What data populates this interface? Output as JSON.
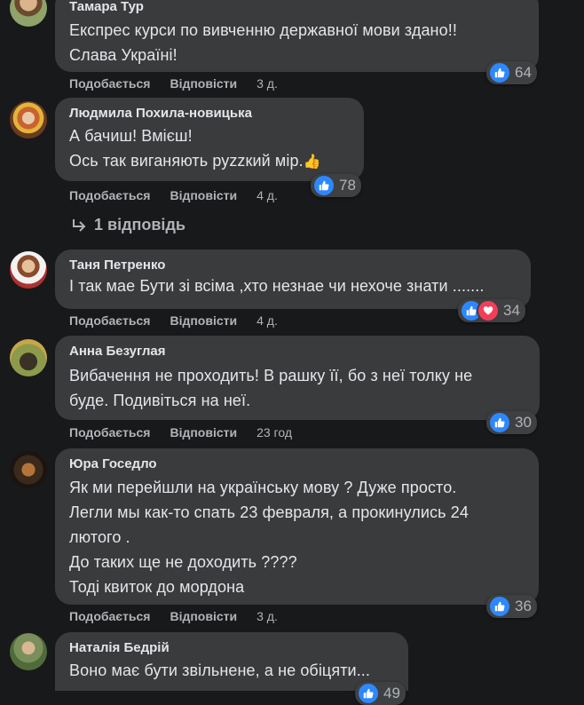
{
  "comments": [
    {
      "author": "Тамара Тур",
      "text": "Експрес курси по вивченню державної мови здано!!\nСлава Україні!",
      "like": "Подобається",
      "reply": "Відповісти",
      "time": "3 д.",
      "reactions": 64
    },
    {
      "author": "Людмила Похила-новицька",
      "text": "А бачиш! Вмієш!\nОсь так виганяють руzzкий мір.",
      "emoji": "👍",
      "like": "Подобається",
      "reply": "Відповісти",
      "time": "4 д.",
      "reactions": 78,
      "replies_label": "1 відповідь"
    },
    {
      "author": "Таня Петренко",
      "text": "І так мае Бути зі всіма ,хто незнае чи нехоче знати .......",
      "like": "Подобається",
      "reply": "Відповісти",
      "time": "4 д.",
      "reactions": 34
    },
    {
      "author": "Анна Безуглая",
      "text": "Вибачення не проходить! В рашку її, бо з неї толку не\nбуде. Подивіться на неї.",
      "like": "Подобається",
      "reply": "Відповісти",
      "time": "23 год",
      "reactions": 30
    },
    {
      "author": "Юра Госедло",
      "text": "Як ми перейшли на українську мову ? Дуже просто.\nЛегли мы как-то спать 23 февраля, а прокинулись 24\nлютого .\nДо таких ще не доходить ????\nТоді квиток до мордона",
      "like": "Подобається",
      "reply": "Відповісти",
      "time": "3 д.",
      "reactions": 36
    },
    {
      "author": "Наталія Бедрій",
      "text": "Воно має бути звільнене, а не обіцяти...",
      "reactions": 49
    }
  ],
  "colors": {
    "like_blue": "#2d88ff",
    "love_red": "#f33e58",
    "bubble": "#3a3b3c",
    "background": "#18191a"
  }
}
